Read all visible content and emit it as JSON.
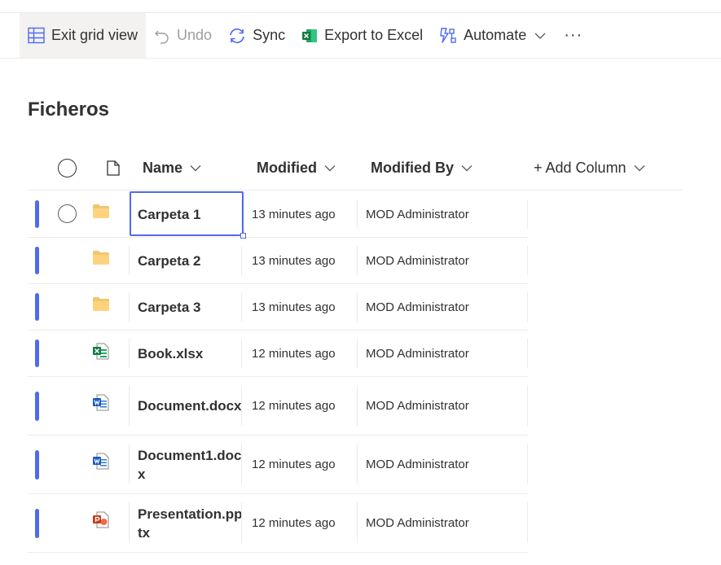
{
  "toolbar": {
    "exit_grid": "Exit grid view",
    "undo": "Undo",
    "sync": "Sync",
    "export": "Export to Excel",
    "automate": "Automate",
    "more": "···"
  },
  "page_title": "Ficheros",
  "columns": {
    "name": "Name",
    "modified": "Modified",
    "modified_by": "Modified By",
    "add_column": "+ Add Column"
  },
  "colors": {
    "accent": "#4f6bed",
    "folder": "#f0c66e",
    "excel": "#21a366",
    "word": "#2b7cd3",
    "powerpoint": "#d35230"
  },
  "rows": [
    {
      "name": "Carpeta 1",
      "modified": "13 minutes ago",
      "modified_by": "MOD Administrator",
      "icon": "folder-icon"
    },
    {
      "name": "Carpeta 2",
      "modified": "13 minutes ago",
      "modified_by": "MOD Administrator",
      "icon": "folder-icon"
    },
    {
      "name": "Carpeta 3",
      "modified": "13 minutes ago",
      "modified_by": "MOD Administrator",
      "icon": "folder-icon"
    },
    {
      "name": "Book.xlsx",
      "modified": "12 minutes ago",
      "modified_by": "MOD Administrator",
      "icon": "excel-file-icon"
    },
    {
      "name": "Document.docx",
      "modified": "12 minutes ago",
      "modified_by": "MOD Administrator",
      "icon": "word-file-icon"
    },
    {
      "name": "Document1.docx",
      "modified": "12 minutes ago",
      "modified_by": "MOD Administrator",
      "icon": "word-file-icon"
    },
    {
      "name": "Presentation.pptx",
      "modified": "12 minutes ago",
      "modified_by": "MOD Administrator",
      "icon": "powerpoint-file-icon"
    }
  ]
}
